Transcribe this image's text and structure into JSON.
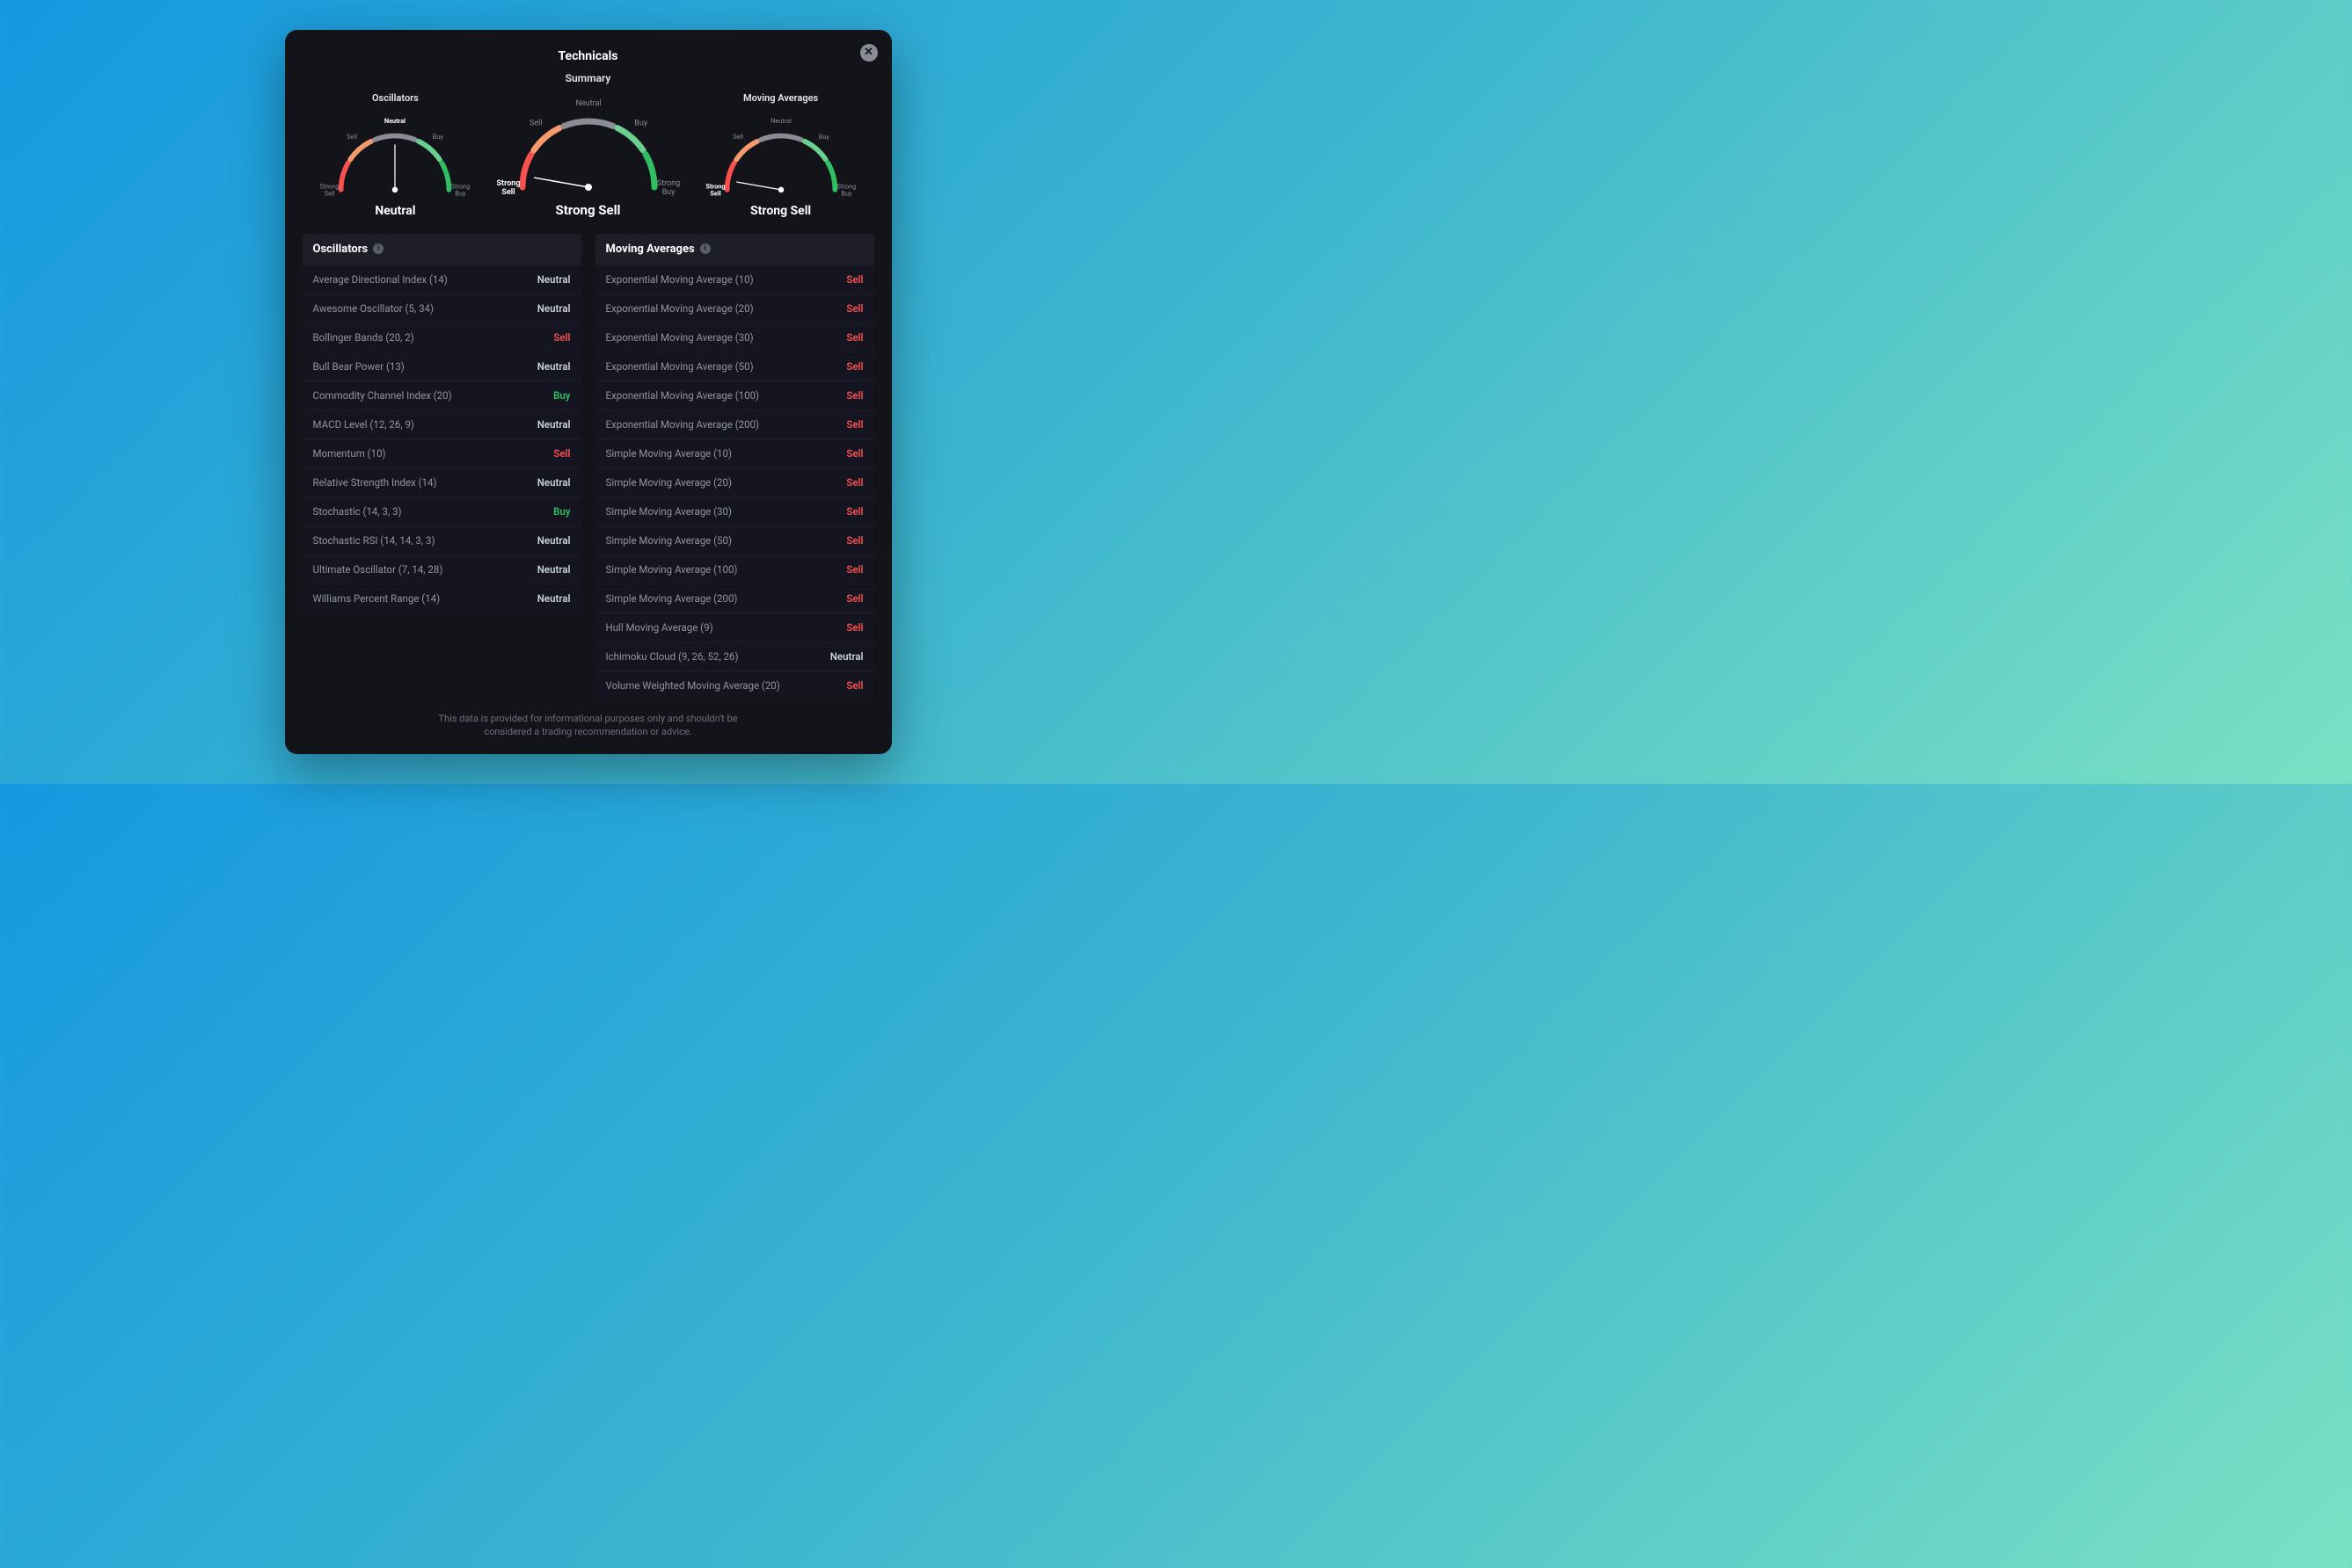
{
  "title": "Technicals",
  "gauge_labels": {
    "strong_sell": "Strong\nSell",
    "sell": "Sell",
    "neutral": "Neutral",
    "buy": "Buy",
    "strong_buy": "Strong\nBuy"
  },
  "gauges": {
    "oscillators": {
      "title": "Oscillators",
      "result": "Neutral",
      "level": "neutral"
    },
    "summary": {
      "title": "Summary",
      "result": "Strong Sell",
      "level": "strong_sell"
    },
    "moving_avg": {
      "title": "Moving Averages",
      "result": "Strong Sell",
      "level": "strong_sell"
    }
  },
  "sections": {
    "oscillators": {
      "header": "Oscillators",
      "rows": [
        {
          "name": "Average Directional Index (14)",
          "signal": "Neutral"
        },
        {
          "name": "Awesome Oscillator (5, 34)",
          "signal": "Neutral"
        },
        {
          "name": "Bollinger Bands (20, 2)",
          "signal": "Sell"
        },
        {
          "name": "Bull Bear Power (13)",
          "signal": "Neutral"
        },
        {
          "name": "Commodity Channel Index (20)",
          "signal": "Buy"
        },
        {
          "name": "MACD Level (12, 26, 9)",
          "signal": "Neutral"
        },
        {
          "name": "Momentum (10)",
          "signal": "Sell"
        },
        {
          "name": "Relative Strength Index (14)",
          "signal": "Neutral"
        },
        {
          "name": "Stochastic (14, 3, 3)",
          "signal": "Buy"
        },
        {
          "name": "Stochastic RSI (14, 14, 3, 3)",
          "signal": "Neutral"
        },
        {
          "name": "Ultimate Oscillator (7, 14, 28)",
          "signal": "Neutral"
        },
        {
          "name": "Williams Percent Range (14)",
          "signal": "Neutral"
        }
      ]
    },
    "moving_averages": {
      "header": "Moving Averages",
      "rows": [
        {
          "name": "Exponential Moving Average (10)",
          "signal": "Sell"
        },
        {
          "name": "Exponential Moving Average (20)",
          "signal": "Sell"
        },
        {
          "name": "Exponential Moving Average (30)",
          "signal": "Sell"
        },
        {
          "name": "Exponential Moving Average (50)",
          "signal": "Sell"
        },
        {
          "name": "Exponential Moving Average (100)",
          "signal": "Sell"
        },
        {
          "name": "Exponential Moving Average (200)",
          "signal": "Sell"
        },
        {
          "name": "Simple Moving Average (10)",
          "signal": "Sell"
        },
        {
          "name": "Simple Moving Average (20)",
          "signal": "Sell"
        },
        {
          "name": "Simple Moving Average (30)",
          "signal": "Sell"
        },
        {
          "name": "Simple Moving Average (50)",
          "signal": "Sell"
        },
        {
          "name": "Simple Moving Average (100)",
          "signal": "Sell"
        },
        {
          "name": "Simple Moving Average (200)",
          "signal": "Sell"
        },
        {
          "name": "Hull Moving Average (9)",
          "signal": "Sell"
        },
        {
          "name": "Ichimoku Cloud (9, 26, 52, 26)",
          "signal": "Neutral"
        },
        {
          "name": "Volume Weighted Moving Average (20)",
          "signal": "Sell"
        }
      ]
    }
  },
  "disclaimer_line1": "This data is provided for informational purposes only and shouldn't be",
  "disclaimer_line2": "considered a trading recommendation or advice."
}
